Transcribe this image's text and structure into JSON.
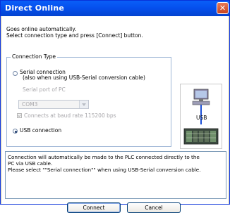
{
  "window": {
    "title": "Direct Online",
    "close_icon": "close-icon"
  },
  "intro": {
    "line1": "Goes online automatically.",
    "line2": "Select connection type and press [Connect] button."
  },
  "connection_type": {
    "legend": "Connection Type",
    "serial_label": "Serial connection",
    "serial_sub": "(also when using USB-Serial conversion cable)",
    "serial_port_label": "Serial port of PC",
    "serial_port_value": "COM3",
    "baud_label": "Connects at baud rate 115200 bps",
    "usb_label": "USB connection",
    "selected": "usb"
  },
  "illustration": {
    "usb_label": "USB"
  },
  "message": {
    "line1": "Connection will automatically be made to the PLC connected directly to the",
    "line2": "PC via USB cable.",
    "line3": "Please select \"\"Serial connection\"\" when using USB-Serial conversion cable."
  },
  "buttons": {
    "connect": "Connect",
    "cancel": "Cancel"
  },
  "colors": {
    "title_bar": "#0550ee",
    "group_border": "#9fb6d6",
    "disabled_text": "#a7a6aa"
  }
}
